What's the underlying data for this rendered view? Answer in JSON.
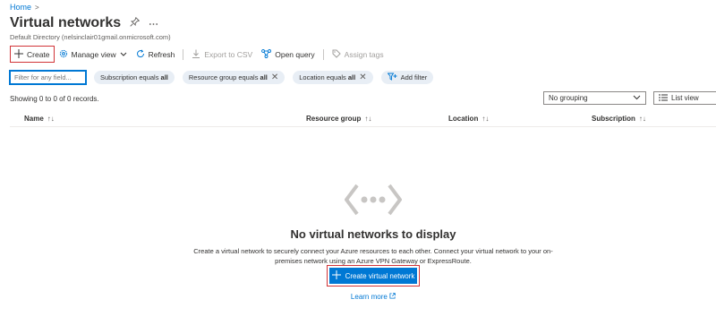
{
  "breadcrumb": {
    "home": "Home",
    "separator": ">"
  },
  "header": {
    "title": "Virtual networks",
    "directory": "Default Directory (nelsinclair01gmail.onmicrosoft.com)"
  },
  "toolbar": {
    "create": "Create",
    "manage_view": "Manage view",
    "refresh": "Refresh",
    "export_csv": "Export to CSV",
    "open_query": "Open query",
    "assign_tags": "Assign tags"
  },
  "filters": {
    "placeholder": "Filter for any field...",
    "pills": [
      {
        "label": "Subscription equals ",
        "value": "all",
        "removable": false
      },
      {
        "label": "Resource group equals ",
        "value": "all",
        "removable": true
      },
      {
        "label": "Location equals ",
        "value": "all",
        "removable": true
      }
    ],
    "add_filter": "Add filter"
  },
  "records": "Showing 0 to 0 of 0 records.",
  "grouping": {
    "selected": "No grouping"
  },
  "view": {
    "selected": "List view"
  },
  "table": {
    "columns": [
      {
        "label": "Name",
        "sort": "↑↓"
      },
      {
        "label": "Resource group",
        "sort": "↑↓"
      },
      {
        "label": "Location",
        "sort": "↑↓"
      },
      {
        "label": "Subscription",
        "sort": "↑↓"
      }
    ]
  },
  "empty_state": {
    "title": "No virtual networks to display",
    "description": "Create a virtual network to securely connect your Azure resources to each other. Connect your virtual network to your on-premises network using an Azure VPN Gateway or ExpressRoute.",
    "cta": "Create virtual network",
    "learn_more": "Learn more"
  },
  "colors": {
    "accent": "#0078d4",
    "highlight_border": "#d13438",
    "pill_bg": "#e8eef5"
  }
}
